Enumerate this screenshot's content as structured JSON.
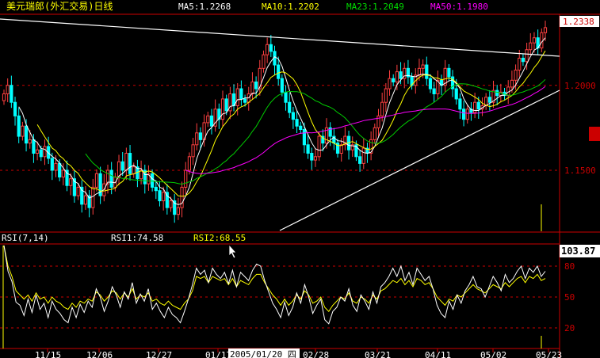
{
  "header": {
    "title": "美元瑞郎(外汇交易)日线",
    "ma5": "MA5:1.2268",
    "ma10": "MA10:1.2202",
    "ma23": "MA23:1.2049",
    "ma50": "MA50:1.1980"
  },
  "rsi_header": {
    "name": "RSI(7,14)",
    "rsi1": "RSI1:74.58",
    "rsi2": "RSI2:68.55"
  },
  "price_labels": {
    "current": "1.2338",
    "p1": "1.2000",
    "p2": "1.1500"
  },
  "rsi_labels": {
    "current": "103.87",
    "l80": "80",
    "l50": "50",
    "l20": "20"
  },
  "date_axis": {
    "ticks": [
      "11/15",
      "12/06",
      "12/27",
      "01/17",
      "02/28",
      "03/21",
      "04/11",
      "05/02",
      "05/23"
    ],
    "cursor_date": "2005/01/20 四"
  },
  "colors": {
    "up": "#ff4040",
    "down": "#00ffff",
    "ma5": "#ffffff",
    "ma10": "#ffff00",
    "ma23": "#00cc00",
    "ma50": "#ff00ff",
    "title": "#ffff00",
    "axis": "#cc0000"
  },
  "chart_data": [
    {
      "type": "candlestick",
      "title": "美元瑞郎(外汇交易)日线",
      "ylim": [
        1.115,
        1.24
      ],
      "series": [
        {
          "name": "MA5",
          "last": 1.2268
        },
        {
          "name": "MA10",
          "last": 1.2202
        },
        {
          "name": "MA23",
          "last": 1.2049
        },
        {
          "name": "MA50",
          "last": 1.198
        }
      ],
      "y_ticks": [
        1.2,
        1.15
      ],
      "last_close": 1.2338,
      "close": [
        1.195,
        1.2,
        1.19,
        1.182,
        1.17,
        1.176,
        1.166,
        1.168,
        1.16,
        1.162,
        1.158,
        1.164,
        1.157,
        1.15,
        1.154,
        1.146,
        1.15,
        1.141,
        1.145,
        1.135,
        1.14,
        1.13,
        1.135,
        1.128,
        1.14,
        1.148,
        1.135,
        1.142,
        1.15,
        1.14,
        1.146,
        1.155,
        1.15,
        1.16,
        1.148,
        1.152,
        1.145,
        1.15,
        1.142,
        1.148,
        1.14,
        1.138,
        1.132,
        1.137,
        1.128,
        1.132,
        1.124,
        1.128,
        1.14,
        1.15,
        1.158,
        1.165,
        1.172,
        1.168,
        1.178,
        1.182,
        1.176,
        1.186,
        1.18,
        1.192,
        1.185,
        1.195,
        1.188,
        1.198,
        1.192,
        1.19,
        1.195,
        1.202,
        1.198,
        1.21,
        1.218,
        1.224,
        1.22,
        1.212,
        1.204,
        1.196,
        1.19,
        1.184,
        1.18,
        1.176,
        1.174,
        1.165,
        1.16,
        1.156,
        1.158,
        1.17,
        1.166,
        1.175,
        1.17,
        1.166,
        1.16,
        1.165,
        1.17,
        1.162,
        1.165,
        1.158,
        1.154,
        1.163,
        1.16,
        1.168,
        1.175,
        1.182,
        1.19,
        1.198,
        1.204,
        1.202,
        1.208,
        1.204,
        1.21,
        1.205,
        1.2,
        1.206,
        1.21,
        1.212,
        1.204,
        1.198,
        1.195,
        1.203,
        1.2,
        1.21,
        1.205,
        1.198,
        1.192,
        1.186,
        1.18,
        1.186,
        1.184,
        1.19,
        1.186,
        1.188,
        1.193,
        1.19,
        1.197,
        1.194,
        1.196,
        1.194,
        1.199,
        1.203,
        1.209,
        1.216,
        1.214,
        1.221,
        1.225,
        1.228,
        1.222,
        1.231,
        1.234
      ]
    },
    {
      "type": "line",
      "title": "RSI(7,14)",
      "ylim": [
        0,
        100
      ],
      "y_ticks": [
        80,
        50,
        20
      ],
      "series": [
        {
          "name": "RSI1",
          "last": 74.58,
          "values": [
            100,
            75,
            65,
            45,
            42,
            32,
            48,
            35,
            52,
            38,
            44,
            30,
            46,
            38,
            34,
            28,
            25,
            40,
            30,
            43,
            35,
            46,
            40,
            58,
            50,
            36,
            46,
            60,
            52,
            40,
            55,
            48,
            64,
            44,
            53,
            46,
            58,
            38,
            44,
            36,
            30,
            40,
            33,
            30,
            25,
            36,
            48,
            62,
            78,
            72,
            76,
            64,
            78,
            72,
            68,
            74,
            63,
            76,
            60,
            74,
            70,
            66,
            76,
            82,
            80,
            66,
            55,
            44,
            38,
            30,
            45,
            32,
            40,
            54,
            44,
            62,
            50,
            34,
            42,
            48,
            28,
            24,
            36,
            40,
            50,
            46,
            58,
            42,
            36,
            52,
            46,
            38,
            55,
            44,
            60,
            64,
            70,
            78,
            70,
            80,
            66,
            74,
            62,
            78,
            72,
            66,
            70,
            58,
            42,
            34,
            30,
            46,
            38,
            52,
            44,
            56,
            62,
            70,
            60,
            58,
            50,
            60,
            70,
            64,
            56,
            72,
            64,
            68,
            75,
            80,
            68,
            78,
            74,
            80,
            70,
            75
          ]
        },
        {
          "name": "RSI2",
          "last": 68.55,
          "values": [
            100,
            80,
            70,
            56,
            52,
            48,
            52,
            46,
            54,
            48,
            50,
            44,
            50,
            46,
            44,
            40,
            38,
            44,
            40,
            46,
            44,
            48,
            46,
            55,
            52,
            46,
            50,
            56,
            54,
            48,
            54,
            50,
            58,
            48,
            52,
            50,
            54,
            46,
            48,
            44,
            42,
            46,
            42,
            40,
            38,
            44,
            48,
            56,
            70,
            68,
            70,
            64,
            70,
            68,
            66,
            68,
            62,
            68,
            60,
            66,
            64,
            62,
            68,
            72,
            72,
            64,
            58,
            52,
            48,
            42,
            48,
            42,
            46,
            52,
            48,
            56,
            52,
            44,
            46,
            50,
            40,
            36,
            42,
            46,
            50,
            48,
            54,
            46,
            44,
            50,
            48,
            44,
            52,
            48,
            56,
            58,
            62,
            66,
            64,
            68,
            62,
            66,
            60,
            68,
            66,
            62,
            64,
            58,
            50,
            46,
            42,
            48,
            46,
            52,
            50,
            54,
            58,
            62,
            58,
            56,
            54,
            58,
            62,
            60,
            58,
            64,
            60,
            64,
            68,
            70,
            64,
            70,
            68,
            72,
            66,
            68
          ]
        }
      ]
    }
  ]
}
